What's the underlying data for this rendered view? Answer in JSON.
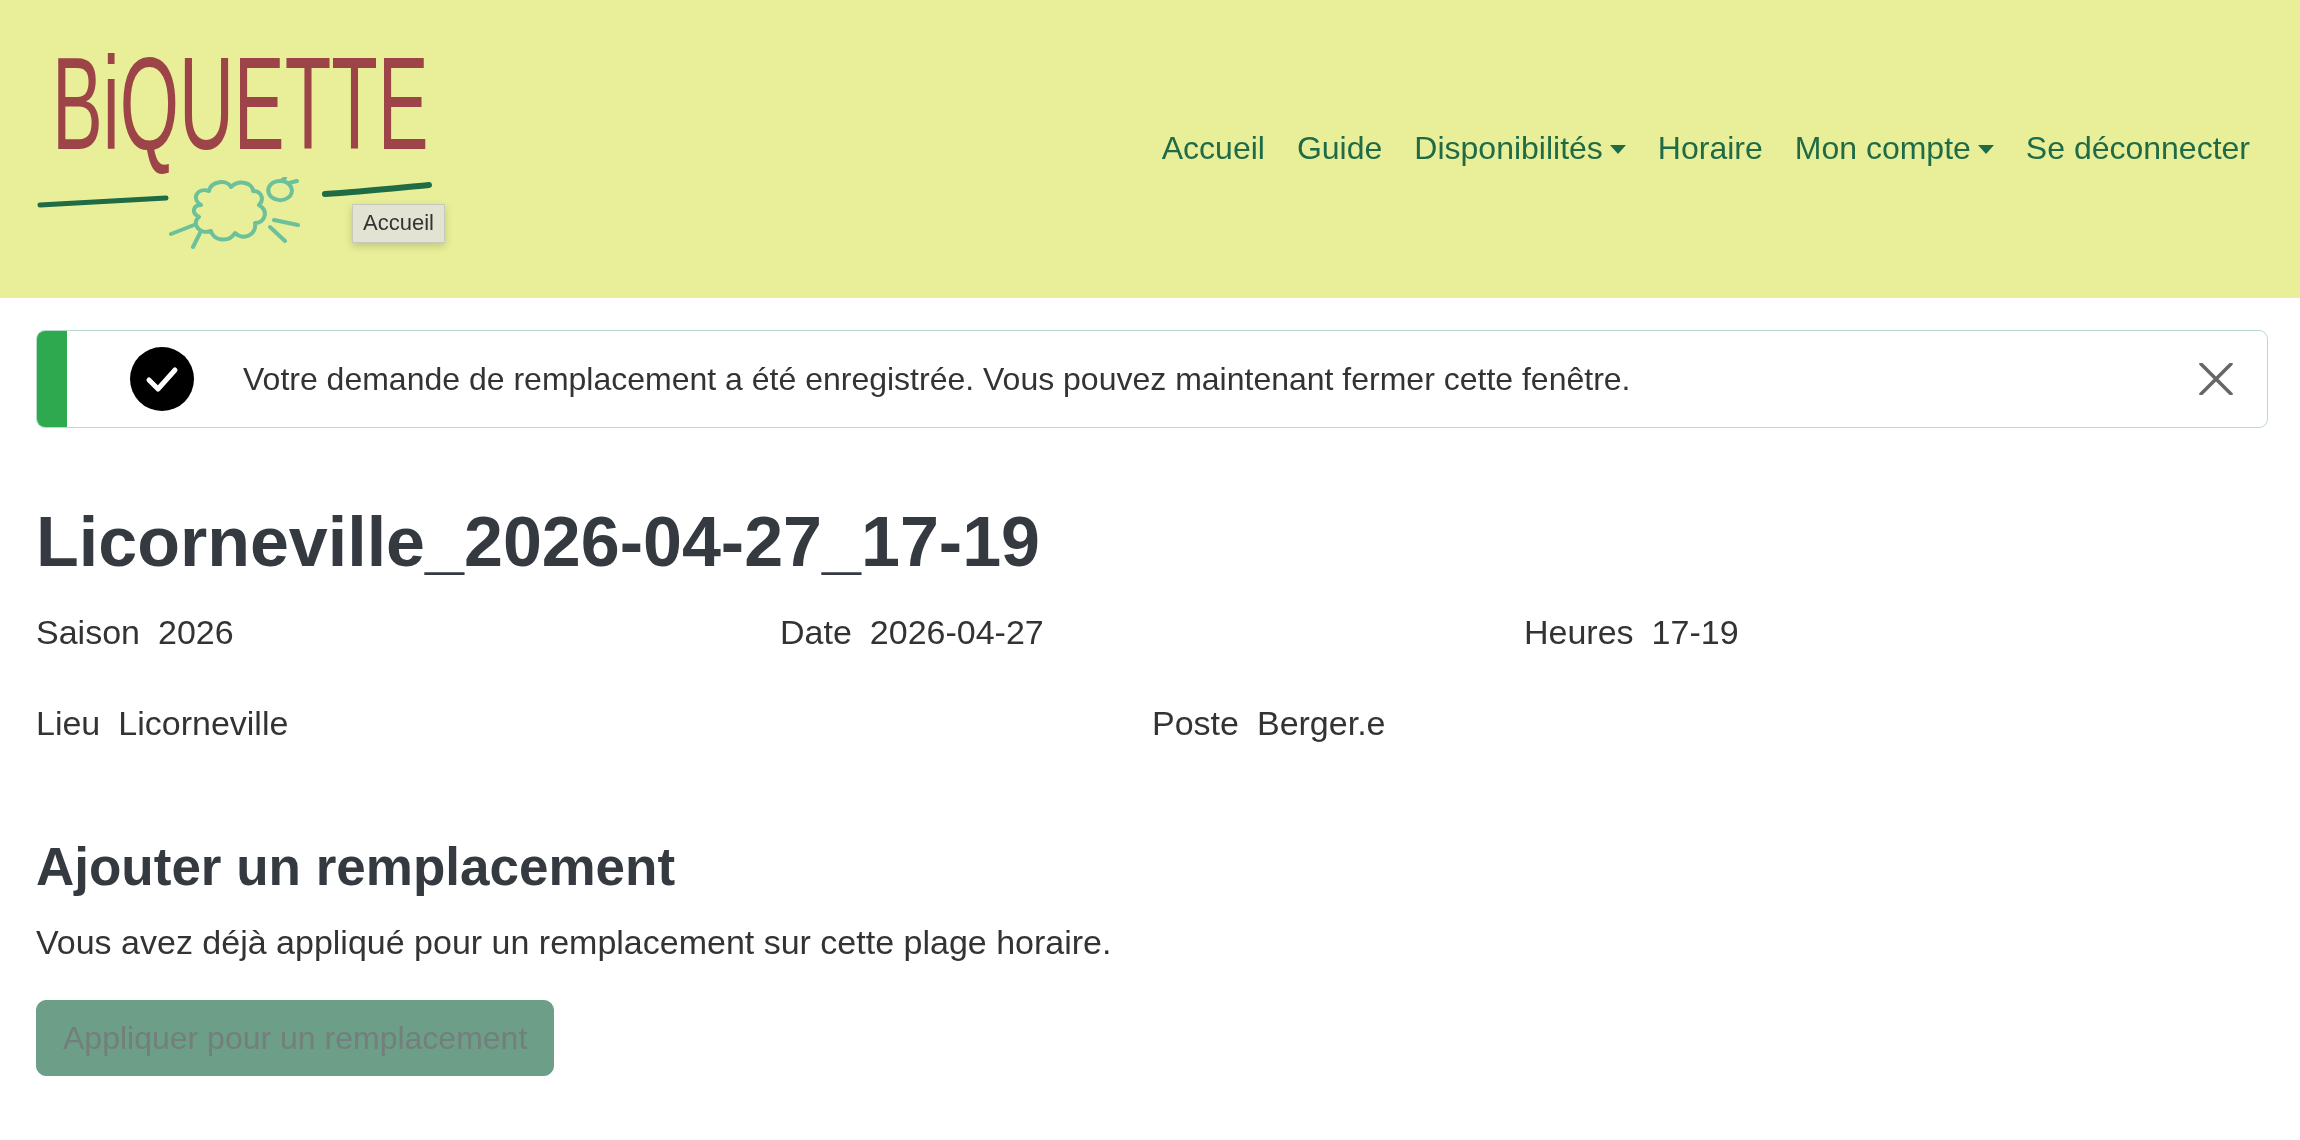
{
  "header": {
    "logo": {
      "wordmark": "BiQUETTE",
      "tooltip": "Accueil"
    },
    "nav": [
      {
        "label": "Accueil",
        "dropdown": false
      },
      {
        "label": "Guide",
        "dropdown": false
      },
      {
        "label": "Disponibilités",
        "dropdown": true
      },
      {
        "label": "Horaire",
        "dropdown": false
      },
      {
        "label": "Mon compte",
        "dropdown": true
      },
      {
        "label": "Se déconnecter",
        "dropdown": false
      }
    ]
  },
  "alert": {
    "kind": "success",
    "message": "Votre demande de remplacement a été enregistrée. Vous pouvez maintenant fermer cette fenêtre.",
    "dismissible": true
  },
  "title": "Licorneville_2026-04-27_17-19",
  "details": {
    "rows": [
      {
        "fields": [
          {
            "label": "Saison",
            "value": "2026"
          },
          {
            "label": "Date",
            "value": "2026-04-27"
          },
          {
            "label": "Heures",
            "value": "17-19"
          }
        ]
      },
      {
        "fields": [
          {
            "label": "Lieu",
            "value": "Licorneville"
          },
          {
            "label": "Poste",
            "value": "Berger.e"
          }
        ]
      }
    ]
  },
  "replacement": {
    "heading": "Ajouter un remplacement",
    "message": "Vous avez déjà appliqué pour un remplacement sur cette plage horaire.",
    "button": {
      "label": "Appliquer pour un remplacement",
      "disabled": true
    }
  }
}
